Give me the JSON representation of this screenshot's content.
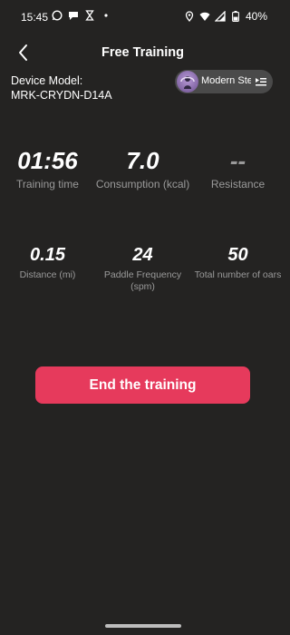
{
  "status_bar": {
    "time": "15:45",
    "battery": "40%"
  },
  "header": {
    "title": "Free Training"
  },
  "device": {
    "label": "Device Model:",
    "model": "MRK-CRYDN-D14A"
  },
  "mode_chip": {
    "name": "Modern Ste"
  },
  "stats_top": [
    {
      "value": "01:56",
      "label": "Training time"
    },
    {
      "value": "7.0",
      "label": "Consumption (kcal)"
    },
    {
      "value": "--",
      "label": "Resistance"
    }
  ],
  "stats_bottom": [
    {
      "value": "0.15",
      "label": "Distance (mi)"
    },
    {
      "value": "24",
      "label": "Paddle Frequency (spm)"
    },
    {
      "value": "50",
      "label": "Total number of oars"
    }
  ],
  "actions": {
    "end_label": "End the training"
  },
  "colors": {
    "background": "#242322",
    "accent": "#e63a5c",
    "label_gray": "#9a9a9a",
    "chip": "#4a4a4a"
  },
  "icons": [
    "whatsapp-icon",
    "chat-icon",
    "hourglass-icon",
    "dot-icon",
    "location-icon",
    "wifi-icon",
    "signal-icon",
    "battery-icon",
    "back-arrow-icon",
    "menu-icon"
  ]
}
